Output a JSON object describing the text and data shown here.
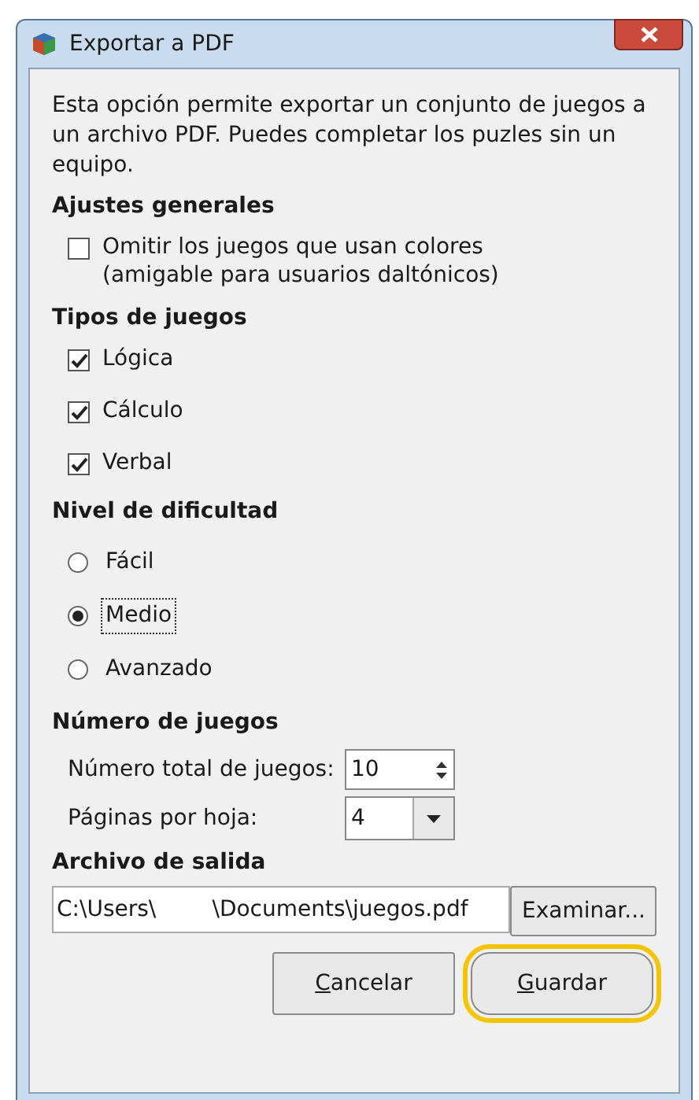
{
  "window": {
    "title": "Exportar a PDF"
  },
  "description": "Esta opción permite exportar un conjunto de juegos a un archivo PDF. Puedes completar los puzles sin un equipo.",
  "general": {
    "heading": "Ajustes generales",
    "options": [
      {
        "label": "Omitir los juegos que usan colores\n(amigable para usuarios daltónicos)",
        "checked": false
      }
    ]
  },
  "game_types": {
    "heading": "Tipos de juegos",
    "options": [
      {
        "label": "Lógica",
        "checked": true
      },
      {
        "label": "Cálculo",
        "checked": true
      },
      {
        "label": "Verbal",
        "checked": true
      }
    ]
  },
  "difficulty": {
    "heading": "Nivel de dificultad",
    "options": [
      {
        "label": "Fácil",
        "selected": false,
        "focused": false
      },
      {
        "label": "Medio",
        "selected": true,
        "focused": true
      },
      {
        "label": "Avanzado",
        "selected": false,
        "focused": false
      }
    ]
  },
  "count": {
    "heading": "Número de juegos",
    "total_label": "Número total de juegos:",
    "total_value": "10",
    "pages_label": "Páginas por hoja:",
    "pages_value": "4"
  },
  "output": {
    "heading": "Archivo de salida",
    "path": "C:\\Users\\        \\Documents\\juegos.pdf",
    "browse": "Examinar..."
  },
  "buttons": [
    {
      "label": "Cancelar",
      "underline_first": true,
      "highlighted": false
    },
    {
      "label": "Guardar",
      "underline_first": true,
      "highlighted": true
    }
  ]
}
